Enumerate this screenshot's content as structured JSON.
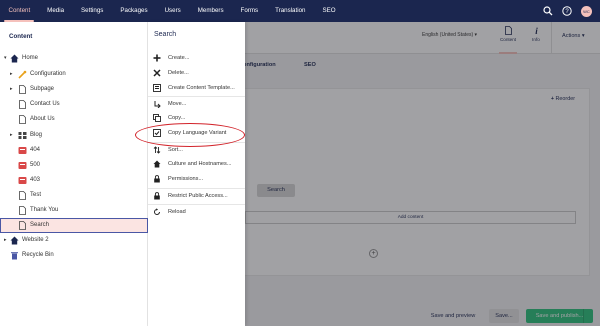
{
  "topnav": {
    "items": [
      "Content",
      "Media",
      "Settings",
      "Packages",
      "Users",
      "Members",
      "Forms",
      "Translation",
      "SEO"
    ],
    "active": "Content",
    "avatar_initials": "WC"
  },
  "tree": {
    "title": "Content",
    "nodes": [
      {
        "label": "Home",
        "icon": "home-icon",
        "arrow": "▾"
      },
      {
        "label": "Configuration",
        "icon": "wrench-icon",
        "arrow": "▸"
      },
      {
        "label": "Subpage",
        "icon": "document-icon",
        "arrow": "▸"
      },
      {
        "label": "Contact Us",
        "icon": "document-icon",
        "arrow": ""
      },
      {
        "label": "About Us",
        "icon": "document-icon",
        "arrow": ""
      },
      {
        "label": "Blog",
        "icon": "blog-icon",
        "arrow": "▸"
      },
      {
        "label": "404",
        "icon": "error-page-icon",
        "arrow": ""
      },
      {
        "label": "500",
        "icon": "error-page-icon",
        "arrow": ""
      },
      {
        "label": "403",
        "icon": "error-page-icon",
        "arrow": ""
      },
      {
        "label": "Test",
        "icon": "document-icon",
        "arrow": ""
      },
      {
        "label": "Thank You",
        "icon": "document-icon",
        "arrow": ""
      },
      {
        "label": "Search",
        "icon": "document-icon",
        "arrow": ""
      },
      {
        "label": "Website 2",
        "icon": "home-icon",
        "arrow": "▸"
      },
      {
        "label": "Recycle Bin",
        "icon": "trash-icon",
        "arrow": ""
      }
    ]
  },
  "menu": {
    "title": "Search",
    "items": [
      {
        "label": "Create...",
        "icon": "plus-icon"
      },
      {
        "label": "Delete...",
        "icon": "close-icon"
      },
      {
        "label": "Create Content Template...",
        "icon": "template-icon"
      },
      {
        "label": "Move...",
        "icon": "move-icon"
      },
      {
        "label": "Copy...",
        "icon": "copy-icon"
      },
      {
        "label": "Copy Language Variant",
        "icon": "language-copy-icon"
      },
      {
        "label": "Sort...",
        "icon": "sort-icon"
      },
      {
        "label": "Culture and Hostnames...",
        "icon": "home-icon"
      },
      {
        "label": "Permissions...",
        "icon": "lock-icon"
      },
      {
        "label": "Restrict Public Access...",
        "icon": "lock-icon"
      },
      {
        "label": "Reload",
        "icon": "reload-icon"
      }
    ]
  },
  "editor": {
    "language": "English (United States)",
    "app_tabs": {
      "content": "Content",
      "info": "Info"
    },
    "actions": "Actions",
    "subtabs": [
      "Configuration",
      "SEO"
    ],
    "reorder": "Reorder",
    "search_button": "Search",
    "add_content": "Add content",
    "footer": {
      "preview": "Save and preview",
      "save": "Save...",
      "publish": "Save and publish..."
    }
  },
  "colors": {
    "topbar": "#1b264f",
    "accent": "#f5c1bc",
    "publish": "#2bc37c",
    "highlight": "#d2232a"
  }
}
